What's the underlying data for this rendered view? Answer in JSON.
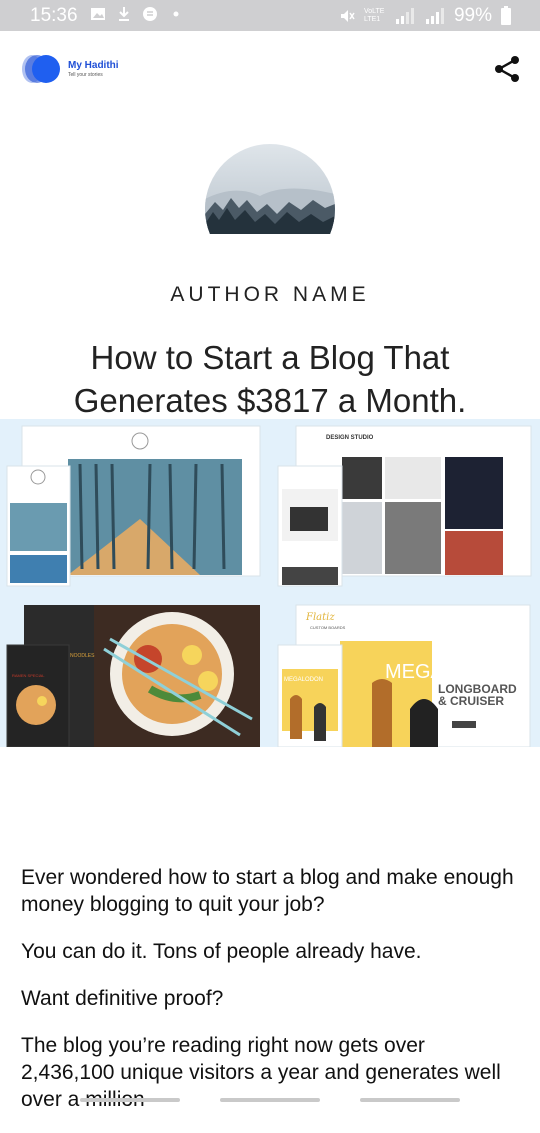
{
  "status_bar": {
    "time": "15:36",
    "network_label": "VoLTE LTE1",
    "battery": "99%"
  },
  "header": {
    "brand_name": "My Hadithi",
    "brand_tagline": "Tell your stories"
  },
  "article": {
    "author": "AUTHOR NAME",
    "title_line1": "How to Start a Blog That",
    "title_line2": "Generates $3817 a Month.",
    "paragraphs": [
      "Ever wondered how to start a blog and make enough money blogging to quit your job?",
      "You can do it. Tons of people already have.",
      "Want definitive proof?",
      "The blog you’re reading right now gets over 2,436,100 unique visitors a year and generates well over a million"
    ]
  },
  "hero_mockups": {
    "studio_label": "DESIGN STUDIO",
    "board_brand": "Flatiz",
    "board_sub": "CUSTOM BOARDS",
    "board_hero": "MEGALODON",
    "board_hero_small": "MEGALODON",
    "board_line1": "LONGBOARD",
    "board_line2": "& CRUISER",
    "noodle_label": "NOODLES",
    "ramen_label": "RAMEN SPECIAL",
    "colors": {
      "brand_blue": "#1f4fd6",
      "hero_bg": "#e3f1fb",
      "board_yellow": "#f7d35a"
    }
  }
}
